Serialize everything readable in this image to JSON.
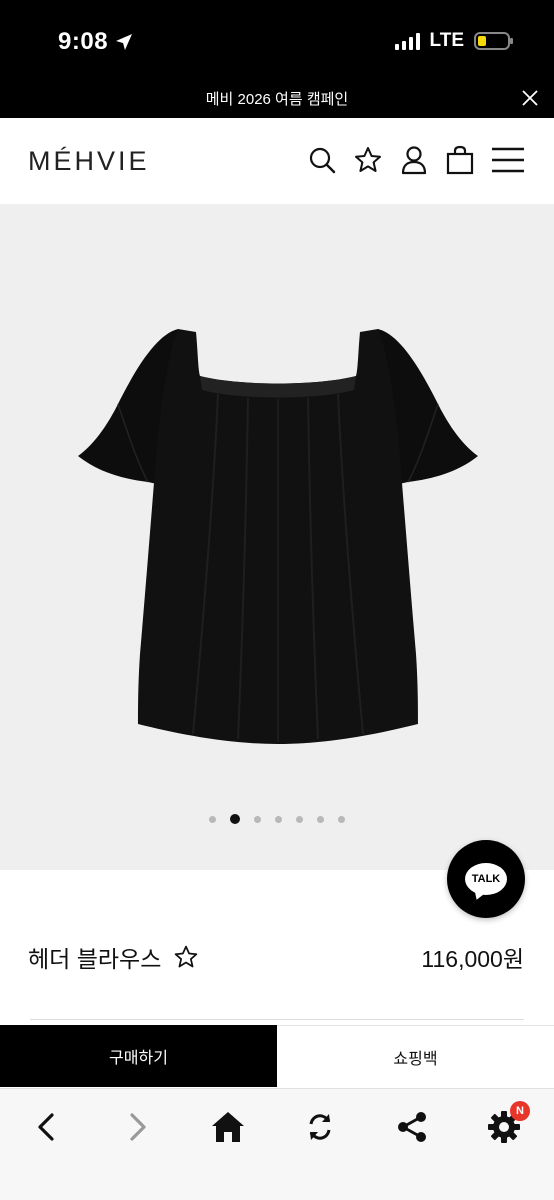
{
  "status_bar": {
    "time": "9:08",
    "network": "LTE"
  },
  "promo": {
    "text": "메비 2026 여름 캠페인"
  },
  "header": {
    "logo": "MÉHVIE"
  },
  "product": {
    "name": "헤더 블라우스",
    "price": "116,000원",
    "image_count": 7,
    "active_image": 2
  },
  "talk": {
    "label": "TALK"
  },
  "actions": {
    "buy_label": "구매하기",
    "cart_label": "쇼핑백"
  },
  "toolbar": {
    "badge": "N"
  },
  "colors": {
    "primary": "#000000",
    "background": "#efefef",
    "badge": "#e8352a"
  }
}
